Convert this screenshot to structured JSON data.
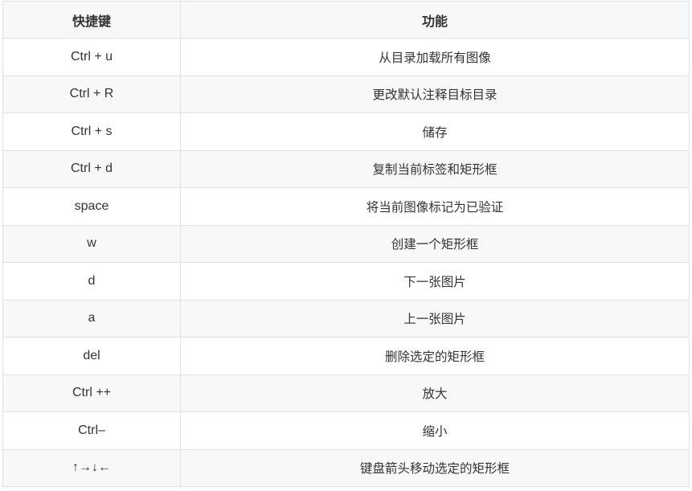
{
  "table": {
    "headers": [
      "快捷键",
      "功能"
    ],
    "rows": [
      {
        "key": "Ctrl + u",
        "func": "从目录加载所有图像"
      },
      {
        "key": "Ctrl + R",
        "func": "更改默认注释目标目录"
      },
      {
        "key": "Ctrl + s",
        "func": "储存"
      },
      {
        "key": "Ctrl + d",
        "func": "复制当前标签和矩形框"
      },
      {
        "key": "space",
        "func": "将当前图像标记为已验证"
      },
      {
        "key": "w",
        "func": "创建一个矩形框"
      },
      {
        "key": "d",
        "func": "下一张图片"
      },
      {
        "key": "a",
        "func": "上一张图片"
      },
      {
        "key": "del",
        "func": "删除选定的矩形框"
      },
      {
        "key": "Ctrl ++",
        "func": "放大"
      },
      {
        "key": "Ctrl–",
        "func": "缩小"
      },
      {
        "key": "↑→↓←",
        "func": "键盘箭头移动选定的矩形框"
      }
    ]
  },
  "colors": {
    "border": "#dfe2e5",
    "header_bg": "#f6f8fa",
    "row_alt_bg": "#f8f8f8",
    "text": "#333333"
  }
}
